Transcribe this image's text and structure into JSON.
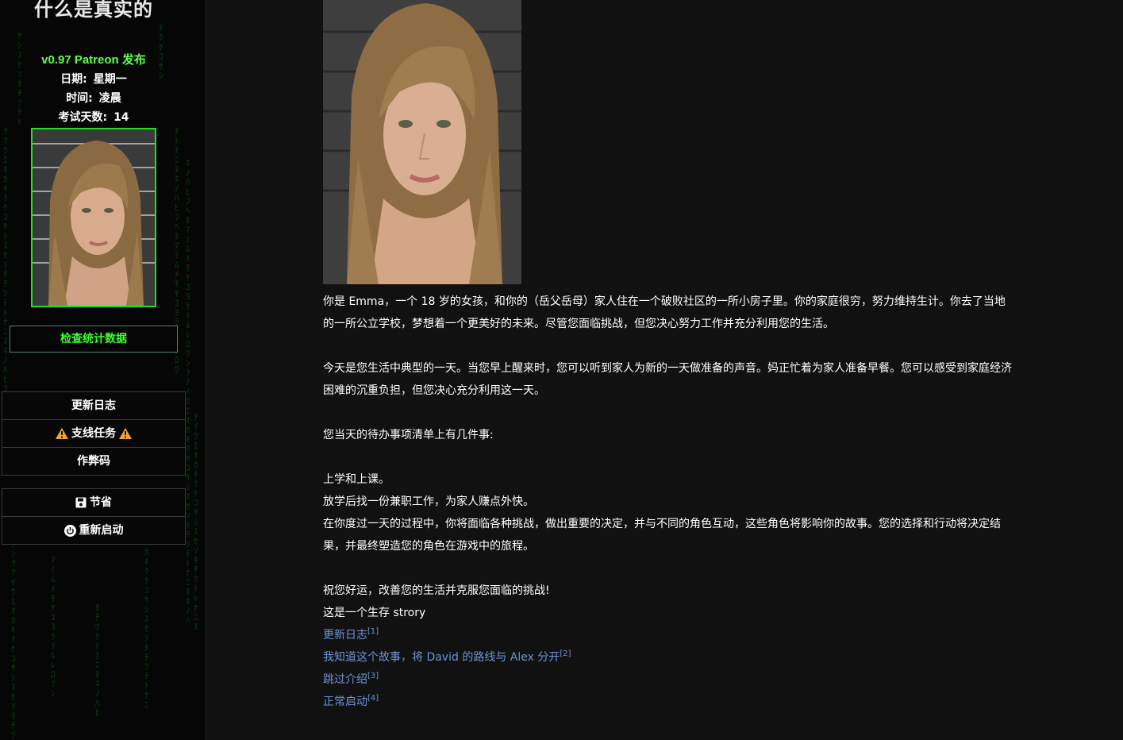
{
  "sidebar": {
    "title": "什么是真实的",
    "version": "v0.97 Patreon 发布",
    "date_label": "日期:",
    "date_value": "星期一",
    "time_label": "时间:",
    "time_value": "凌晨",
    "exam_label": "考试天数:",
    "exam_value": "14",
    "portrait_icon": "portrait-image",
    "stats_button": "检查统计数据",
    "menu": {
      "changelog": "更新日志",
      "side_quests": "支线任务",
      "cheats": "作弊码",
      "save": "节省",
      "restart": "重新启动"
    },
    "colors": {
      "accent_green": "#3cff2e",
      "warning": "#f0a431"
    }
  },
  "main": {
    "hero_icon": "character-photo",
    "paragraphs": {
      "p1": "你是 Emma，一个 18 岁的女孩，和你的（岳父岳母）家人住在一个破败社区的一所小房子里。你的家庭很穷，努力维持生计。你去了当地的一所公立学校，梦想着一个更美好的未来。尽管您面临挑战，但您决心努力工作并充分利用您的生活。",
      "p2": "今天是您生活中典型的一天。当您早上醒来时，您可以听到家人为新的一天做准备的声音。妈正忙着为家人准备早餐。您可以感受到家庭经济困难的沉重负担，但您决心充分利用这一天。",
      "p3": "您当天的待办事项清单上有几件事:",
      "todo1": "上学和上课。",
      "todo2": "放学后找一份兼职工作，为家人赚点外快。",
      "todo3": "在你度过一天的过程中，你将面临各种挑战，做出重要的决定，并与不同的角色互动，这些角色将影响你的故事。您的选择和行动将决定结果，并最终塑造您的角色在游戏中的旅程。",
      "p4": "祝您好运，改善您的生活并克服您面临的挑战!",
      "p5": "这是一个生存 strory"
    },
    "links": [
      {
        "text": "更新日志",
        "ref": "[1]"
      },
      {
        "text": "我知道这个故事，将 David 的路线与 Alex 分开",
        "ref": "[2]"
      },
      {
        "text": "跳过介绍",
        "ref": "[3]"
      },
      {
        "text": "正常启动",
        "ref": "[4]"
      }
    ],
    "colors": {
      "link": "#6d94d8",
      "background": "#111111"
    }
  }
}
